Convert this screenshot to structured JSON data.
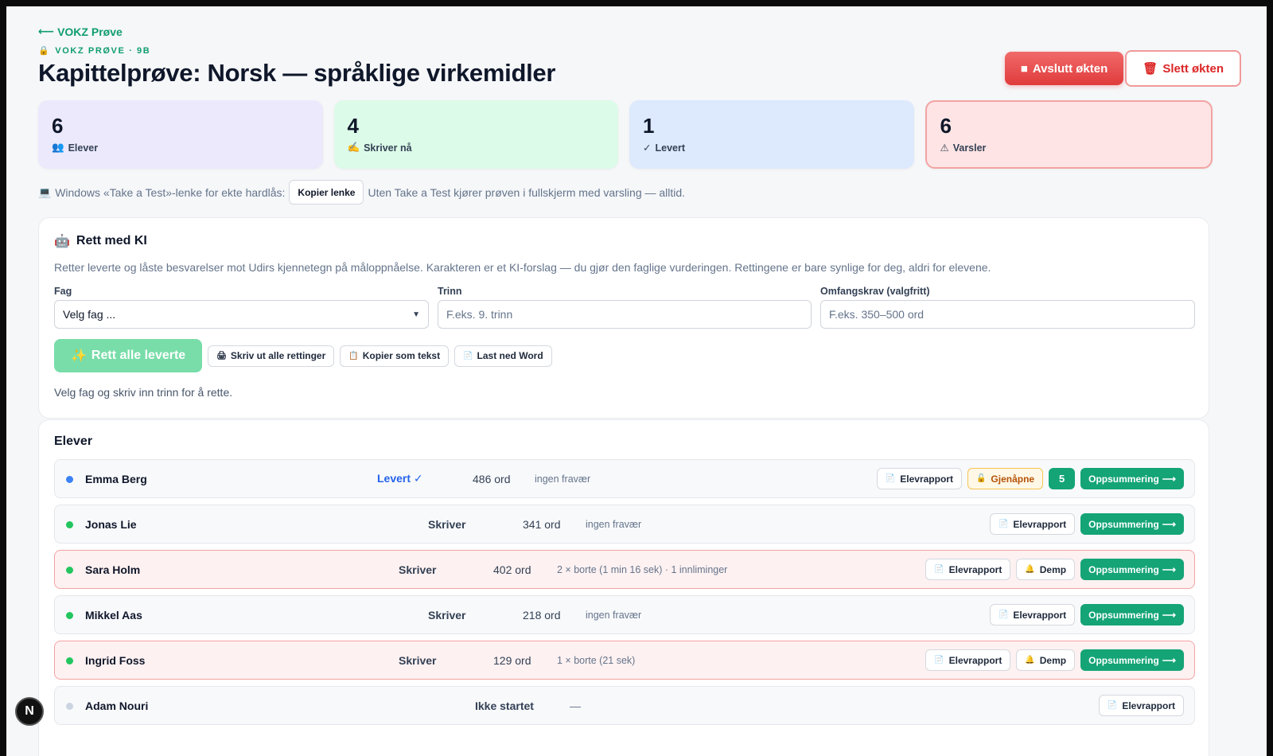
{
  "header": {
    "back_label": "VOKZ Prøve",
    "eyebrow": "VOKZ PRØVE · 9B",
    "title": "Kapittelprøve: Norsk — språklige virkemidler",
    "end_label": "Avslutt økten",
    "delete_label": "Slett økten"
  },
  "stats": [
    {
      "value": "6",
      "label": "Elever"
    },
    {
      "value": "4",
      "label": "Skriver nå"
    },
    {
      "value": "1",
      "label": "Levert"
    },
    {
      "value": "6",
      "label": "Varsler"
    }
  ],
  "take_test": {
    "prefix": "Windows «Take a Test»-lenke for ekte hardlås:",
    "button": "Kopier lenke",
    "suffix": "Uten Take a Test kjører prøven i fullskjerm med varsling — alltid."
  },
  "ki": {
    "title": "Rett med KI",
    "description": "Retter leverte og låste besvarelser mot Udirs kjennetegn på måloppnåelse. Karakteren er et KI-forslag — du gjør den faglige vurderingen. Rettingene er bare synlige for deg, aldri for elevene.",
    "fag_label": "Fag",
    "fag_value": "Velg fag ...",
    "trinn_label": "Trinn",
    "trinn_placeholder": "F.eks. 9. trinn",
    "omfang_label": "Omfangskrav (valgfritt)",
    "omfang_placeholder": "F.eks. 350–500 ord",
    "rett_button": "Rett alle leverte",
    "print_button": "Skriv ut alle rettinger",
    "copy_button": "Kopier som tekst",
    "word_button": "Last ned Word",
    "hint": "Velg fag og skriv inn trinn for å rette."
  },
  "students": {
    "title": "Elever",
    "report_label": "Elevrapport",
    "summary_label": "Oppsummering",
    "reopen_label": "Gjenåpne",
    "demp_label": "Demp",
    "rows": [
      {
        "name": "Emma Berg",
        "status": "Levert ✓",
        "words": "486 ord",
        "absence": "ingen fravær",
        "grade": "5"
      },
      {
        "name": "Jonas Lie",
        "status": "Skriver",
        "words": "341 ord",
        "absence": "ingen fravær"
      },
      {
        "name": "Sara Holm",
        "status": "Skriver",
        "words": "402 ord",
        "absence": "2 × borte (1 min 16 sek) · 1 innliminger"
      },
      {
        "name": "Mikkel Aas",
        "status": "Skriver",
        "words": "218 ord",
        "absence": "ingen fravær"
      },
      {
        "name": "Ingrid Foss",
        "status": "Skriver",
        "words": "129 ord",
        "absence": "1 × borte (21 sek)"
      },
      {
        "name": "Adam Nouri",
        "status": "Ikke startet",
        "words": "",
        "absence": "—"
      }
    ]
  },
  "colors": {
    "accent_green": "#14a476",
    "danger_red": "#e03b3b",
    "levert_blue": "#2563eb"
  },
  "icons": {
    "back": "arrow-left-icon",
    "lock": "lock-icon",
    "stop": "stop-icon",
    "trash": "trash-icon",
    "users": "users-icon",
    "writing": "writing-hand-icon",
    "check": "check-icon",
    "warning": "warning-icon",
    "laptop": "laptop-icon",
    "robot": "robot-icon",
    "sparkle": "sparkle-icon",
    "document": "document-icon",
    "bell": "bell-icon",
    "unlock": "unlock-icon"
  }
}
